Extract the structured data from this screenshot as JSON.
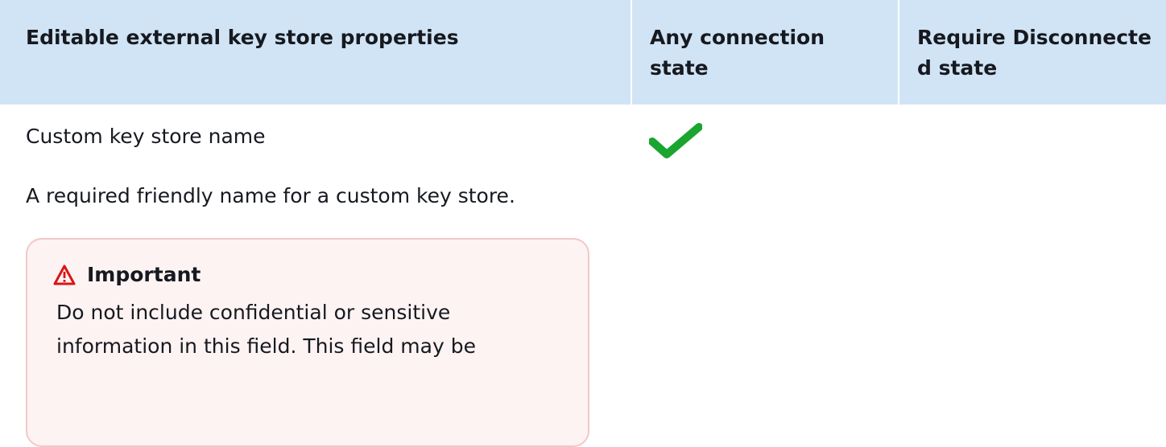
{
  "table": {
    "headers": [
      "Editable external key store properties",
      "Any connection state",
      "Require Disconnected state"
    ],
    "rows": [
      {
        "property_name": "Custom key store name",
        "description": "A required friendly name for a custom key store.",
        "callout": {
          "icon": "warning-triangle-icon",
          "title": "Important",
          "text": "Do not include confidential or sensitive information in this field. This field may be"
        },
        "any_connection_state": "check-icon",
        "require_disconnected_state": ""
      }
    ]
  },
  "colors": {
    "header_background": "#d1e4f5",
    "callout_background": "#fdf3f3",
    "callout_border": "#f3c7c7",
    "warning_red": "#d91515",
    "check_green": "#1aa52f"
  }
}
